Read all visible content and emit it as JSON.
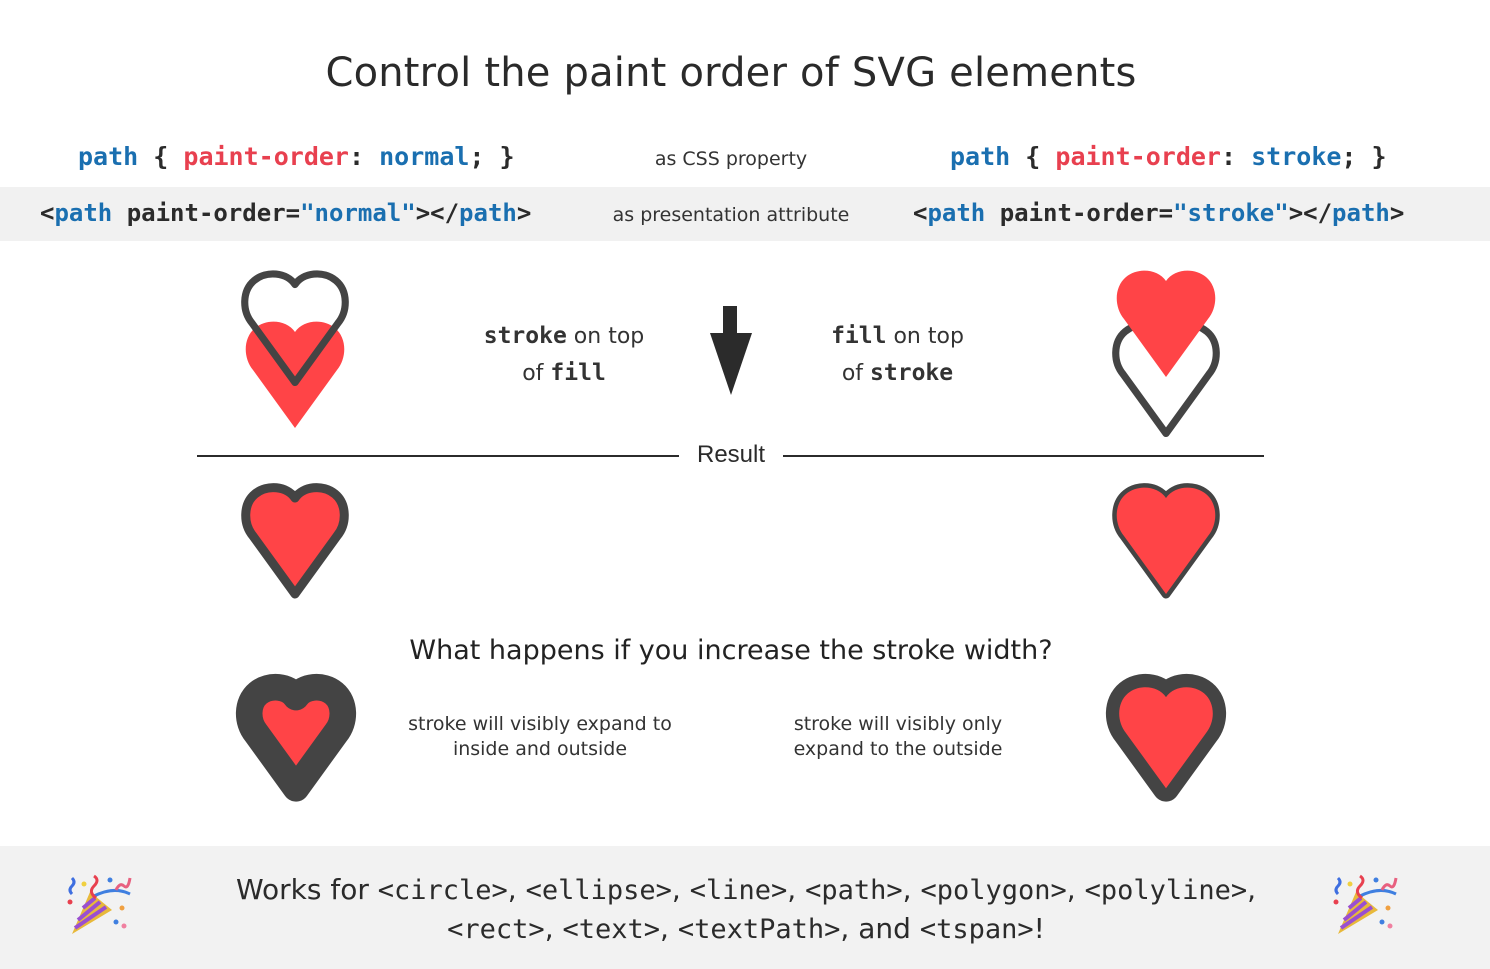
{
  "title": "Control the paint order of SVG elements",
  "colors": {
    "fill_red": "#ff4447",
    "stroke_dark": "#444444",
    "code_blue": "#1a6fb0",
    "code_red": "#e8404f",
    "band_gray": "#f1f1f1"
  },
  "left": {
    "css": {
      "selector": "path",
      "open": "{",
      "property": "paint-order",
      "colon": ":",
      "value": "normal",
      "close": "; }"
    },
    "attr": {
      "lt": "<",
      "tag": "path",
      "attr_name": " paint-order=",
      "attr_value": "\"normal\"",
      "mid": "></",
      "end_tag": "path",
      "gt": ">"
    },
    "description": {
      "word1": "stroke",
      "rest1": " on top",
      "prefix2": "of ",
      "word2": "fill"
    },
    "note": {
      "line1": "stroke will visibly expand to",
      "line2": "inside and outside"
    }
  },
  "right": {
    "css": {
      "selector": "path",
      "open": "{",
      "property": "paint-order",
      "colon": ":",
      "value": "stroke",
      "close": "; }"
    },
    "attr": {
      "lt": "<",
      "tag": "path",
      "attr_name": " paint-order=",
      "attr_value": "\"stroke\"",
      "mid": "></",
      "end_tag": "path",
      "gt": ">"
    },
    "description": {
      "word1": "fill",
      "rest1": " on top",
      "prefix2": "of ",
      "word2": "stroke"
    },
    "note": {
      "line1": "stroke will visibly only",
      "line2": "expand to the outside"
    }
  },
  "captions": {
    "css": "as CSS property",
    "attr": "as presentation attribute"
  },
  "result_label": "Result",
  "question": "What happens if you increase the stroke width?",
  "footer": {
    "prefix": "Works for ",
    "elements_line1": [
      "<circle>",
      "<ellipse>",
      "<line>",
      "<path>",
      "<polygon>",
      "<polyline>"
    ],
    "elements_line2": [
      "<rect>",
      "<text>",
      "<textPath>"
    ],
    "and": "and ",
    "last": "<tspan>",
    "suffix": "!",
    "sep": ", ",
    "emoji_left": "party-popper",
    "emoji_right": "party-popper"
  }
}
